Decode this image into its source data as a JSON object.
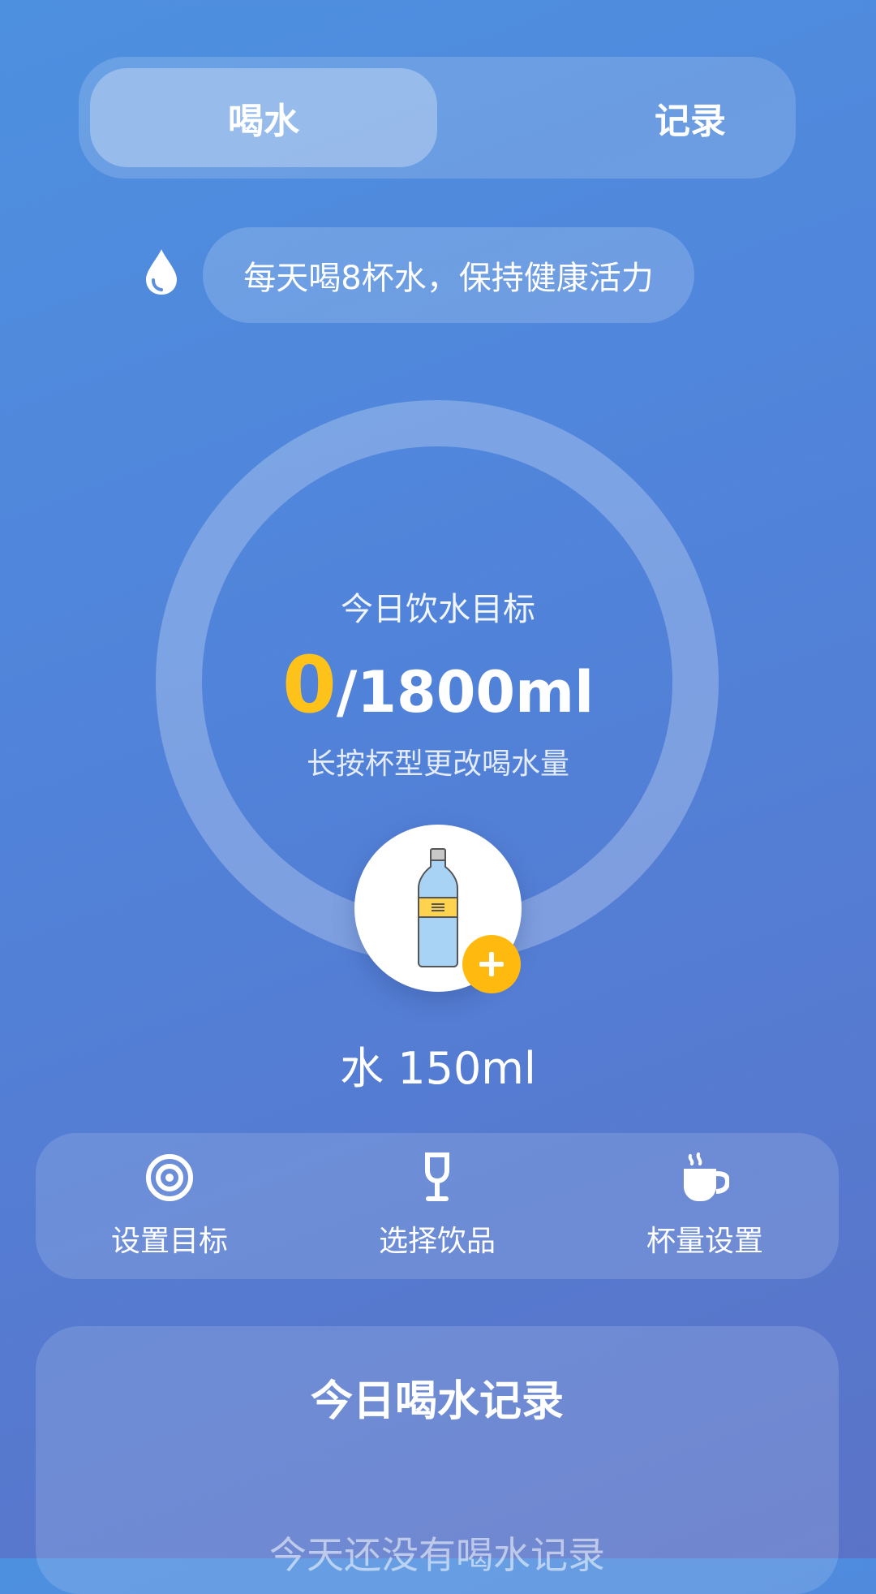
{
  "tabs": [
    {
      "label": "喝水",
      "active": true
    },
    {
      "label": "记录",
      "active": false
    }
  ],
  "tip": {
    "icon": "water-drop-icon",
    "text": "每天喝8杯水，保持健康活力"
  },
  "goal": {
    "label": "今日饮水目标",
    "current": "0",
    "total": "/1800ml",
    "hint": "长按杯型更改喝水量"
  },
  "drink": {
    "icon": "water-bottle-icon",
    "add_icon": "plus-icon",
    "label": "水 150ml"
  },
  "actions": [
    {
      "icon": "target-icon",
      "label": "设置目标"
    },
    {
      "icon": "wine-glass-icon",
      "label": "选择饮品"
    },
    {
      "icon": "coffee-cup-icon",
      "label": "杯量设置"
    }
  ],
  "records": {
    "title": "今日喝水记录",
    "empty_text": "今天还没有喝水记录"
  },
  "colors": {
    "accent": "#ffc21a",
    "badge": "#ffb90f",
    "background_start": "#4e90e0",
    "background_end": "#5a73c7"
  }
}
